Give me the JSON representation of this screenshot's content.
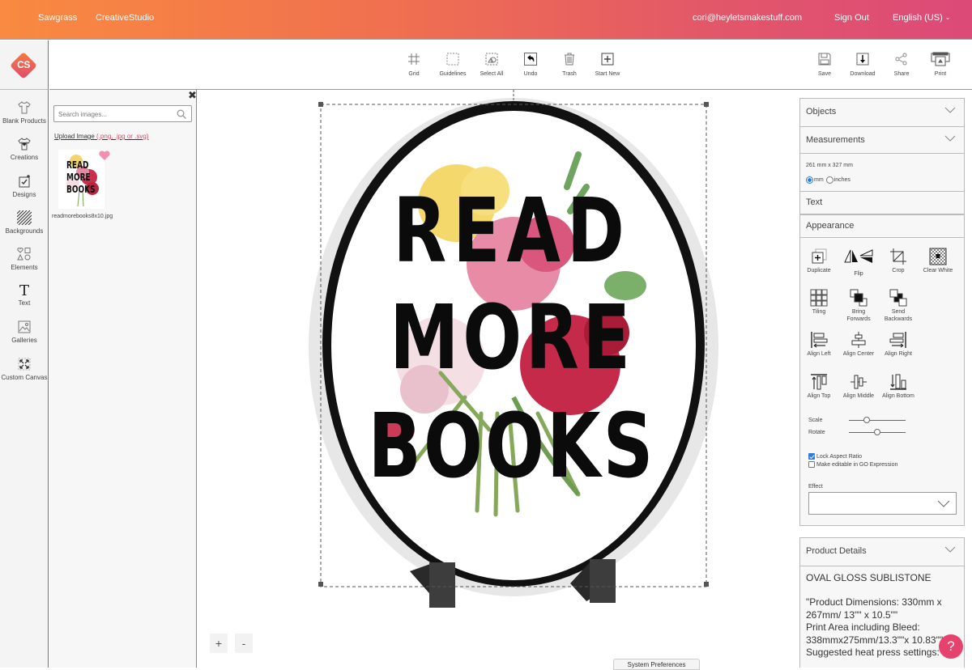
{
  "topbar": {
    "brand": "Sawgrass",
    "app": "CreativeStudio",
    "user_email": "cori@heyletsmakestuff.com",
    "sign_out": "Sign Out",
    "language": "English (US)"
  },
  "logo": {
    "text": "CS"
  },
  "toolbar": {
    "left_tools": [
      {
        "label": "Grid",
        "icon": "grid-icon"
      },
      {
        "label": "Guidelines",
        "icon": "guidelines-icon"
      },
      {
        "label": "Select All",
        "icon": "select-all-icon"
      },
      {
        "label": "Undo",
        "icon": "undo-icon"
      },
      {
        "label": "Trash",
        "icon": "trash-icon"
      },
      {
        "label": "Start New",
        "icon": "plus-square-icon"
      }
    ],
    "right_tools": [
      {
        "label": "Save",
        "icon": "floppy-icon"
      },
      {
        "label": "Download",
        "icon": "download-icon"
      },
      {
        "label": "Share",
        "icon": "share-icon"
      },
      {
        "label": "Print",
        "icon": "printer-icon"
      }
    ]
  },
  "sidebar": {
    "items": [
      {
        "label": "Blank Products",
        "icon": "tshirt-icon"
      },
      {
        "label": "Creations",
        "icon": "tshirt-heart-icon"
      },
      {
        "label": "Designs",
        "icon": "design-icon"
      },
      {
        "label": "Backgrounds",
        "icon": "pattern-icon"
      },
      {
        "label": "Elements",
        "icon": "shapes-icon"
      },
      {
        "label": "Text",
        "icon": "text-icon"
      },
      {
        "label": "Galleries",
        "icon": "image-icon"
      },
      {
        "label": "Custom Canvas",
        "icon": "expand-icon"
      }
    ]
  },
  "image_panel": {
    "search_placeholder": "Search images...",
    "upload_label": "Upload Image",
    "upload_ext": "(.png, .jpg or .svg)",
    "images": [
      {
        "filename": "readmorebooks8x10.jpg",
        "words": [
          "READ",
          "MORE",
          "BOOKS"
        ],
        "favorited": true
      }
    ]
  },
  "canvas": {
    "design_words": [
      "READ",
      "MORE",
      "BOOKS"
    ],
    "zoom_in": "+",
    "zoom_out": "-",
    "system_preferences": "System Preferences"
  },
  "right_panel": {
    "objects": "Objects",
    "measurements": {
      "title": "Measurements",
      "size": "261 mm x 327 mm",
      "units": [
        {
          "label": "mm",
          "selected": true
        },
        {
          "label": "inches",
          "selected": false
        }
      ]
    },
    "text": "Text",
    "appearance": {
      "title": "Appearance",
      "buttons": [
        {
          "label": "Duplicate",
          "icon": "duplicate-icon"
        },
        {
          "label": "Flip",
          "icon": "flip-icon"
        },
        {
          "label": "Crop",
          "icon": "crop-icon"
        },
        {
          "label": "Clear White",
          "icon": "clear-white-icon"
        },
        {
          "label": "Tiling",
          "icon": "tiling-icon"
        },
        {
          "label": "Bring\nForwards",
          "label_lines": [
            "Bring",
            "Forwards"
          ],
          "icon": "bring-forwards-icon"
        },
        {
          "label": "Send\nBackwards",
          "label_lines": [
            "Send",
            "Backwards"
          ],
          "icon": "send-backwards-icon"
        },
        {
          "label": "Align Left",
          "icon": "align-left-icon"
        },
        {
          "label": "Align Center",
          "icon": "align-center-icon"
        },
        {
          "label": "Align Right",
          "icon": "align-right-icon"
        },
        {
          "label": "Align Top",
          "icon": "align-top-icon"
        },
        {
          "label": "Align Middle",
          "icon": "align-middle-icon"
        },
        {
          "label": "Align Bottom",
          "icon": "align-bottom-icon"
        }
      ],
      "scale_label": "Scale",
      "scale_value": 0.32,
      "rotate_label": "Rotate",
      "rotate_value": 0.5,
      "lock_aspect": {
        "label": "Lock Aspect Ratio",
        "checked": true
      },
      "go_expression": {
        "label": "Make editable in GO Expression",
        "checked": false
      },
      "effect_label": "Effect",
      "effect_value": ""
    },
    "product_details": {
      "title": "Product Details",
      "name": "OVAL GLOSS SUBLISTONE",
      "lines": [
        "\"Product Dimensions: 330mm x",
        "267mm/ 13\"\" x 10.5\"\"",
        "Print Area including Bleed:",
        "338mmx275mm/13.3\"\"x 10.83\"\"",
        "Suggested heat press settings:"
      ]
    }
  },
  "help": {
    "label": "?"
  },
  "colors": {
    "header_gradient_start": "#f98a40",
    "header_gradient_end": "#dc4a78",
    "accent_pink": "#e5436e",
    "link_pink": "#d0506c",
    "checkbox_blue": "#2a7ae2"
  }
}
